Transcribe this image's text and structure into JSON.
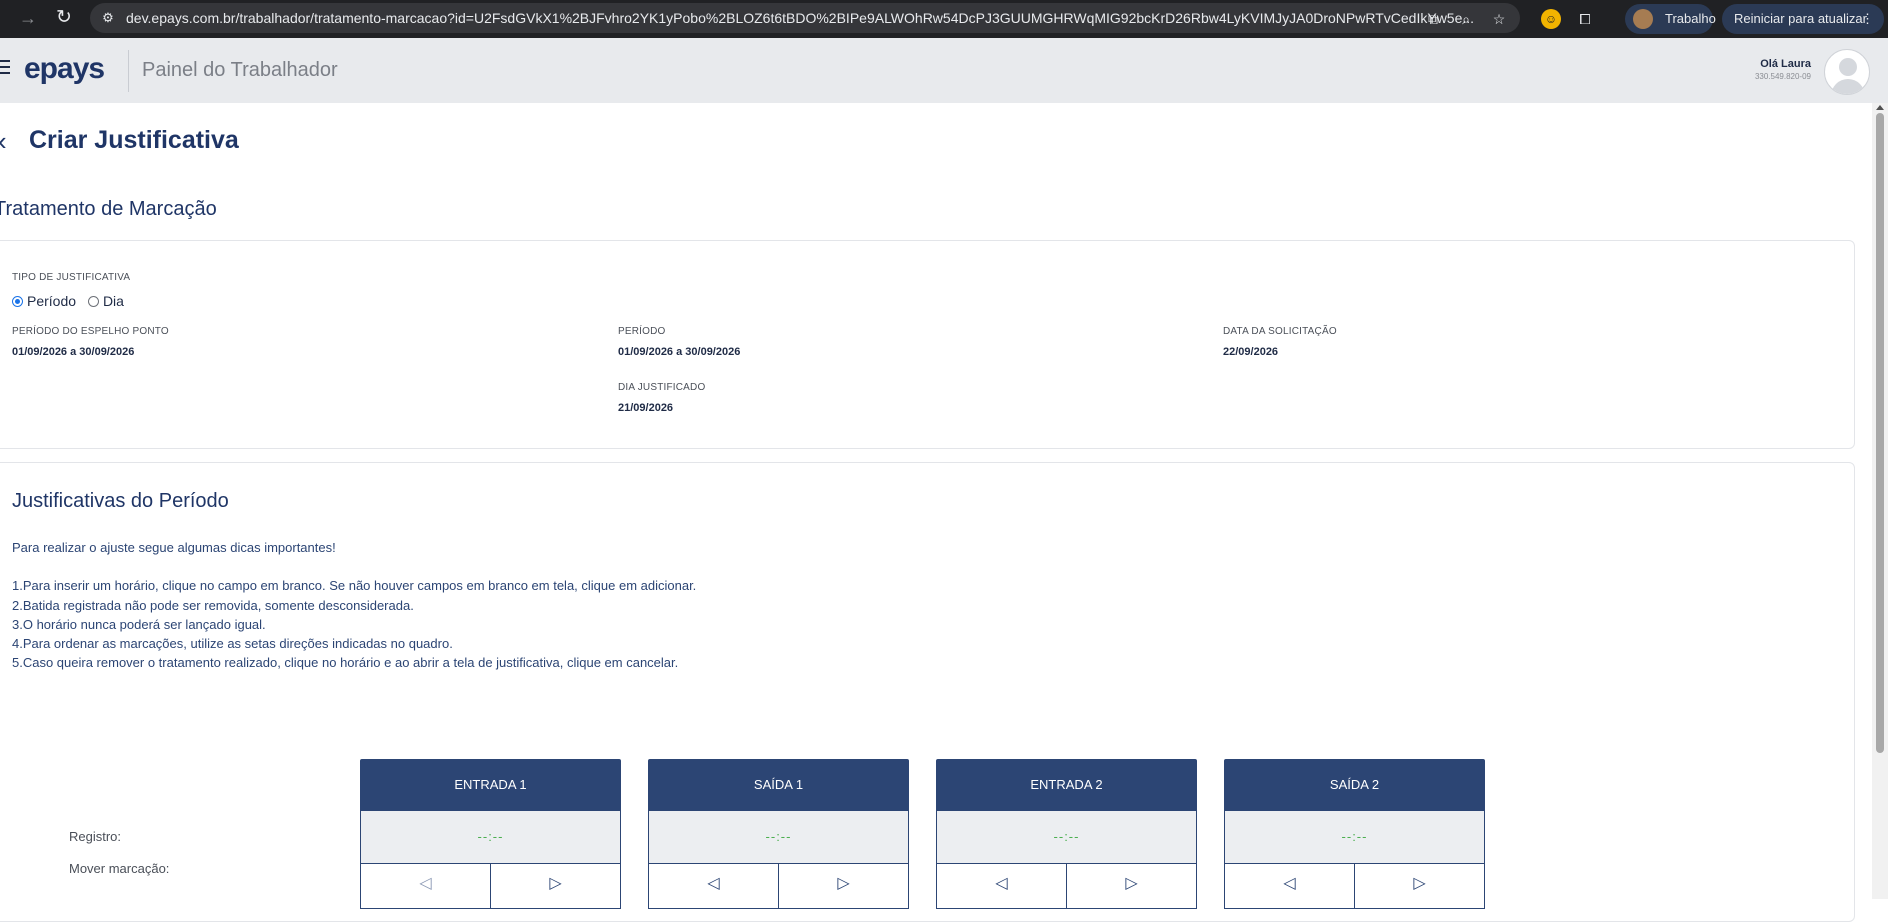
{
  "browser": {
    "url": "dev.epays.com.br/trabalhador/tratamento-marcacao?id=U2FsdGVkX1%2BJFvhro2YK1yPobo%2BLOZ6t6tBDO%2BIPe9ALWOhRw54DcPJ3GUUMGHRWqMIG92bcKrD26Rbw4LyKVIMJyJA0DroNPwRTvCedIkYw5e...",
    "profile_label": "Trabalho",
    "update_label": "Reiniciar para atualizar"
  },
  "header": {
    "logo": "epays",
    "title": "Painel do Trabalhador",
    "greeting": "Olá Laura",
    "cpf": "330.549.820-09"
  },
  "page": {
    "title": "Criar Justificativa",
    "section_title": "Tratamento de Marcação"
  },
  "info": {
    "tipo_label": "TIPO DE JUSTIFICATIVA",
    "options": [
      {
        "label": "Período",
        "checked": true
      },
      {
        "label": "Dia",
        "checked": false
      }
    ],
    "periodo_espelho_label": "PERÍODO DO ESPELHO PONTO",
    "periodo_espelho_value": "01/09/2026 a 30/09/2026",
    "periodo_label": "PERÍODO",
    "periodo_value": "01/09/2026 a 30/09/2026",
    "data_solicitacao_label": "DATA DA SOLICITAÇÃO",
    "data_solicitacao_value": "22/09/2026",
    "dia_justificado_label": "DIA JUSTIFICADO",
    "dia_justificado_value": "21/09/2026"
  },
  "justificativas": {
    "title": "Justificativas do Período",
    "intro": "Para realizar o ajuste segue algumas dicas importantes!",
    "tips": [
      "1.Para inserir um horário, clique no campo em branco. Se não houver campos em branco em tela, clique em adicionar.",
      "2.Batida registrada não pode ser removida, somente desconsiderada.",
      "3.O horário nunca poderá ser lançado igual.",
      "4.Para ordenar as marcações, utilize as setas direções indicadas no quadro.",
      "5.Caso queira remover o tratamento realizado, clique no horário e ao abrir a tela de justificativa, clique em cancelar."
    ],
    "row_registro": "Registro:",
    "row_mover": "Mover marcação:",
    "columns": [
      {
        "header": "ENTRADA 1",
        "registro": "--:--"
      },
      {
        "header": "SAÍDA 1",
        "registro": "--:--"
      },
      {
        "header": "ENTRADA 2",
        "registro": "--:--"
      },
      {
        "header": "SAÍDA 2",
        "registro": "--:--"
      }
    ]
  },
  "icons": {
    "forward": "→",
    "reload": "↻",
    "back": "‹",
    "arrow_left": "◁",
    "arrow_right": "▷"
  }
}
